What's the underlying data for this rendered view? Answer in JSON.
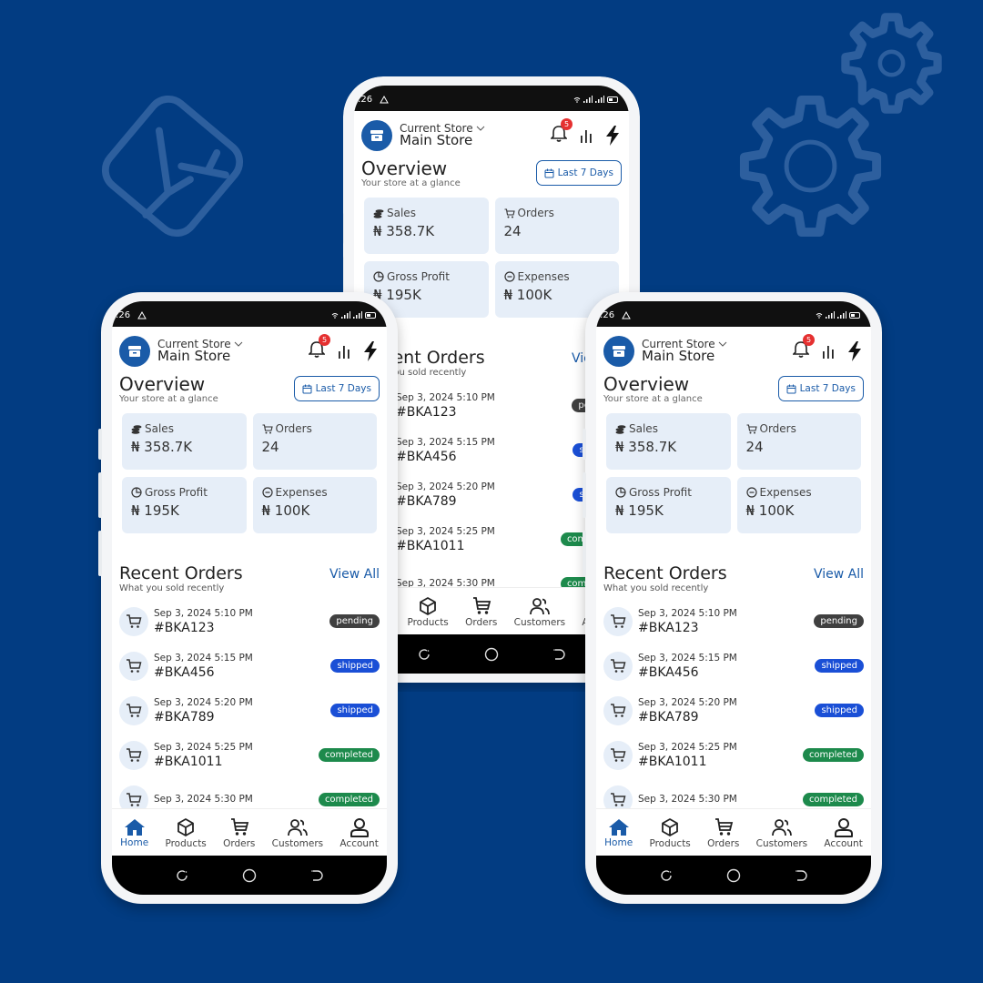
{
  "background": {
    "color": "#023c82",
    "decor_icons": [
      "ruler-compass-icon",
      "large-gear-icon",
      "small-gear-icon"
    ]
  },
  "colors": {
    "brand": "#1a5ba8",
    "card_bg": "#e6eef8",
    "badge_red": "#e53030",
    "pending": "#404040",
    "shipped": "#1a4fd6",
    "completed": "#1d8a4c"
  },
  "phones": [
    {
      "statusbar": {
        "time": ":26",
        "alert_icon": "warning-triangle-icon",
        "right_icons": [
          "wifi-icon",
          "signal-icon",
          "signal-icon",
          "battery-icon"
        ]
      },
      "header": {
        "store_label": "Current Store",
        "store_name": "Main Store",
        "notification_count": "5",
        "icons": [
          "store-icon",
          "chevron-down-icon",
          "bell-icon",
          "bar-chart-icon",
          "lightning-icon"
        ]
      },
      "overview": {
        "title": "Overview",
        "subtitle": "Your store at a glance",
        "range_button": "Last 7 Days"
      },
      "stats": [
        {
          "label": "Sales",
          "value": "₦ 358.7K",
          "icon": "coins-icon"
        },
        {
          "label": "Orders",
          "value": "24",
          "icon": "cart-icon"
        },
        {
          "label": "Gross Profit",
          "value": "₦ 195K",
          "icon": "pie-chart-icon"
        },
        {
          "label": "Expenses",
          "value": "₦ 100K",
          "icon": "minus-circle-icon"
        }
      ],
      "recent_orders": {
        "title": "Recent Orders",
        "subtitle": "What you sold recently",
        "view_all": "View All",
        "items": [
          {
            "date": "Sep 3, 2024 5:10 PM",
            "id": "#BKA123",
            "status": "pending"
          },
          {
            "date": "Sep 3, 2024 5:15 PM",
            "id": "#BKA456",
            "status": "shipped"
          },
          {
            "date": "Sep 3, 2024 5:20 PM",
            "id": "#BKA789",
            "status": "shipped"
          },
          {
            "date": "Sep 3, 2024 5:25 PM",
            "id": "#BKA1011",
            "status": "completed"
          },
          {
            "date": "Sep 3, 2024 5:30 PM",
            "id": "",
            "status": "completed"
          }
        ]
      },
      "bottom_nav": [
        {
          "label": "Home",
          "icon": "home-icon",
          "active": true
        },
        {
          "label": "Products",
          "icon": "box-icon",
          "active": false
        },
        {
          "label": "Orders",
          "icon": "cart-icon",
          "active": false
        },
        {
          "label": "Customers",
          "icon": "users-icon",
          "active": false
        },
        {
          "label": "Account",
          "icon": "user-icon",
          "active": false
        }
      ],
      "system_nav": [
        "recents-icon",
        "home-circle-icon",
        "back-icon"
      ]
    }
  ]
}
